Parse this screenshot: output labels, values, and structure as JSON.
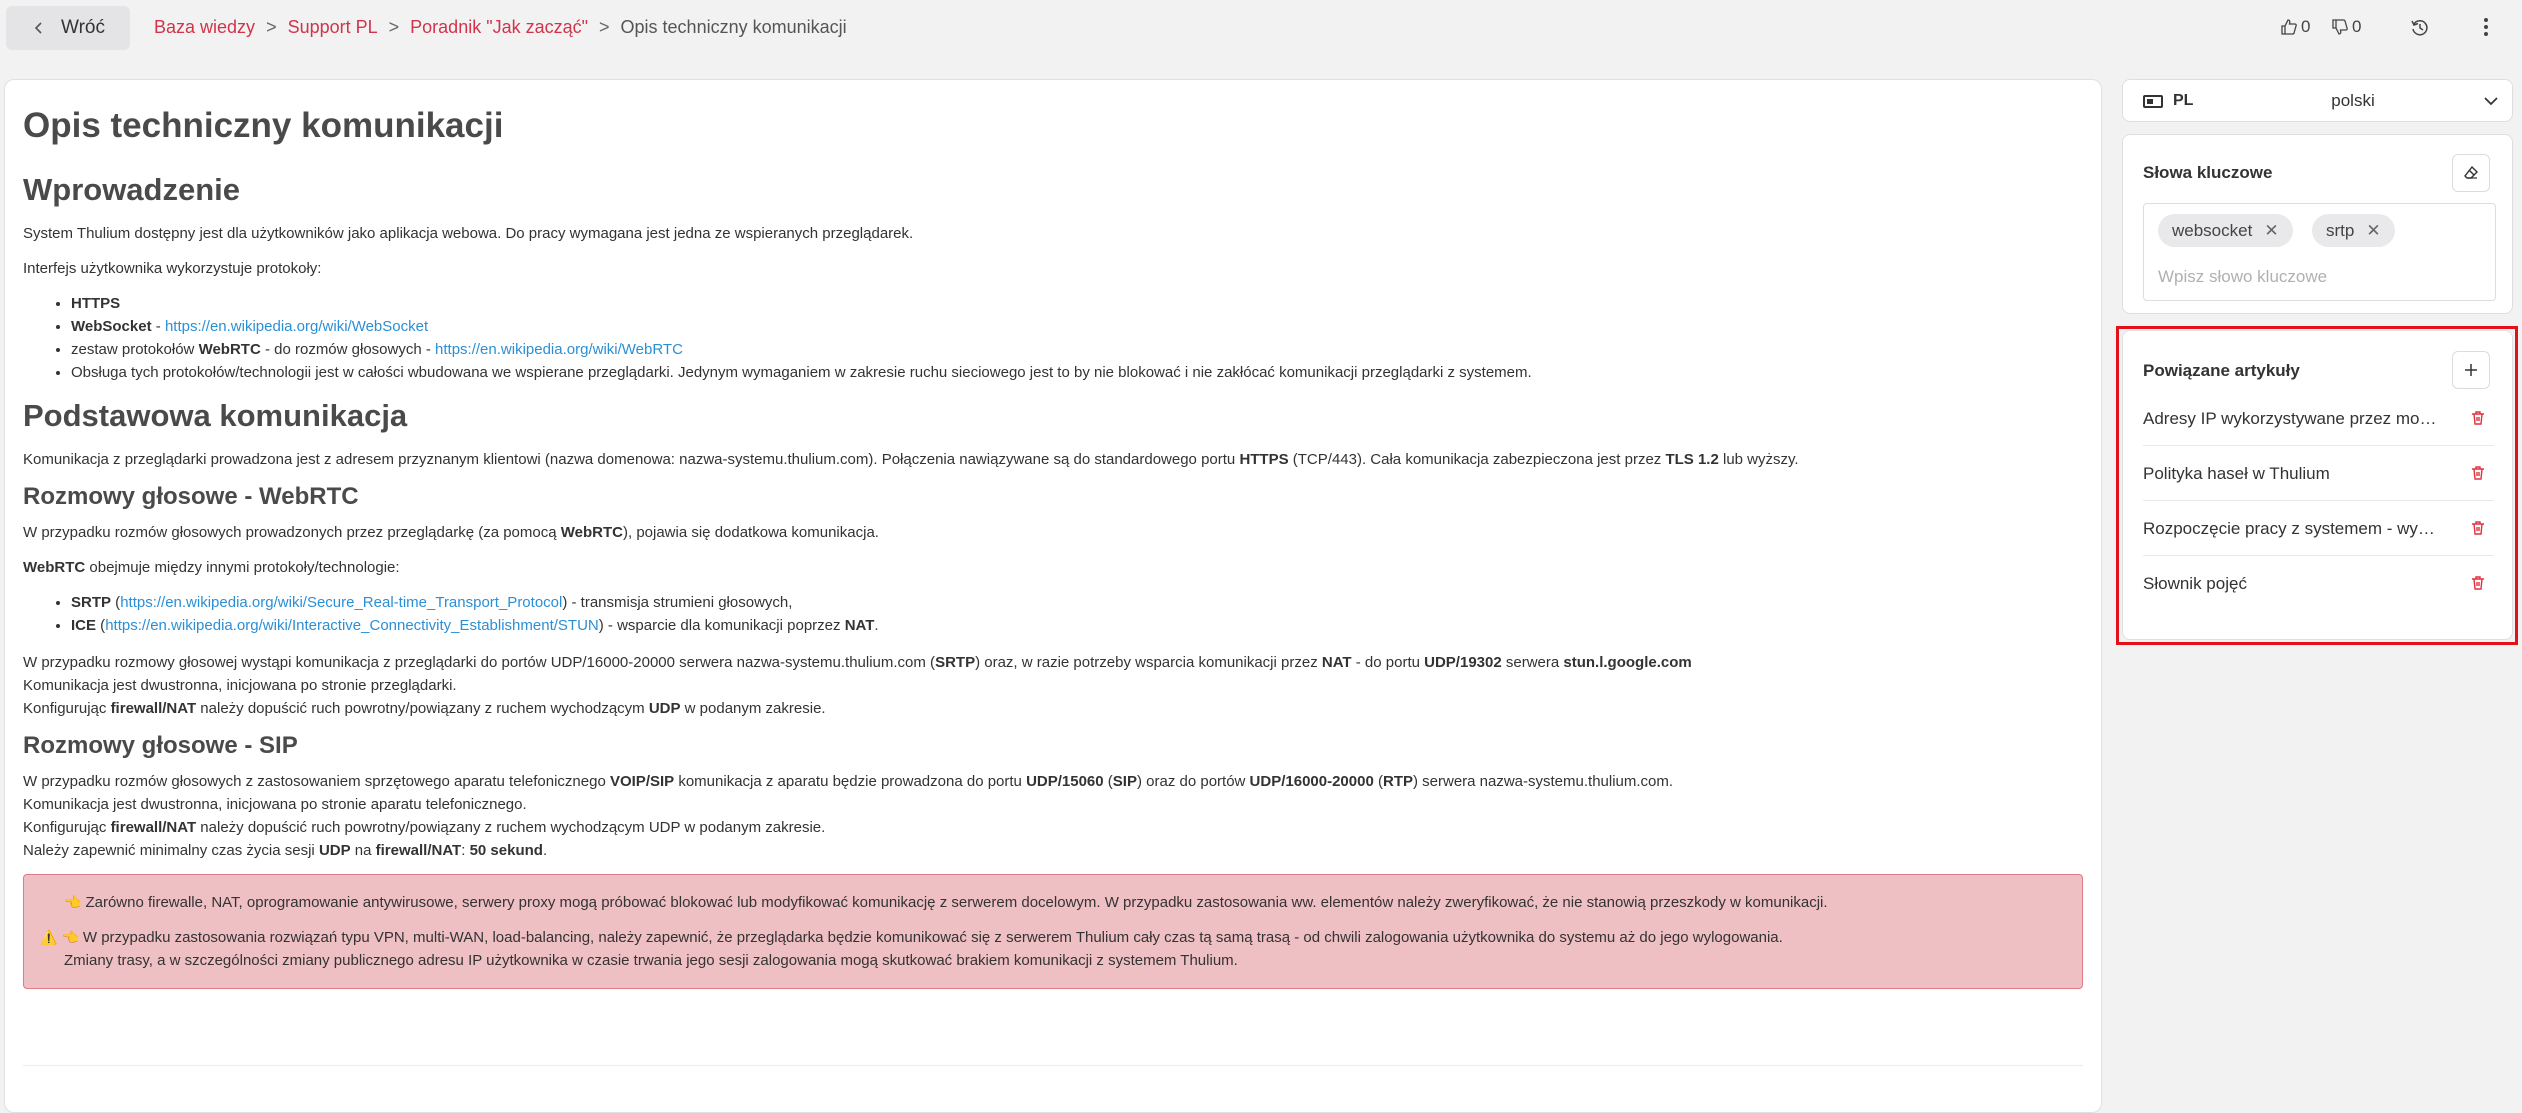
{
  "topbar": {
    "back_label": "Wróć",
    "breadcrumb": [
      {
        "label": "Baza wiedzy"
      },
      {
        "label": "Support PL"
      },
      {
        "label": "Poradnik \"Jak zacząć\""
      }
    ],
    "breadcrumb_separator": ">",
    "breadcrumb_current": "Opis techniczny komunikacji",
    "likes": "0",
    "dislikes": "0",
    "icons": [
      "thumb-up-icon",
      "thumb-down-icon",
      "history-icon",
      "more-vertical-icon"
    ]
  },
  "article": {
    "title": "Opis techniczny komunikacji",
    "s1": {
      "heading": "Wprowadzenie",
      "p1": "System Thulium dostępny jest dla użytkowników jako aplikacja webowa. Do pracy wymagana jest jedna ze wspieranych przeglądarek.",
      "p2": "Interfejs użytkownika wykorzystuje protokoły:",
      "li1_b": "HTTPS",
      "li2_b": "WebSocket",
      "li2_t": " - ",
      "li2_link": "https://en.wikipedia.org/wiki/WebSocket",
      "li3_t1": "zestaw protokołów ",
      "li3_b": "WebRTC",
      "li3_t2": " - do rozmów głosowych - ",
      "li3_link": "https://en.wikipedia.org/wiki/WebRTC",
      "li4": "Obsługa tych protokołów/technologii jest w całości wbudowana we wspierane przeglądarki. Jedynym wymaganiem w zakresie ruchu sieciowego jest to by nie blokować i nie zakłócać komunikacji przeglądarki z systemem."
    },
    "s2": {
      "heading": "Podstawowa komunikacja",
      "p1_t1": "Komunikacja z przeglądarki prowadzona jest z adresem przyznanym klientowi (nazwa domenowa: nazwa-systemu.thulium.com). Połączenia nawiązywane są do standardowego portu ",
      "p1_b1": "HTTPS",
      "p1_t2": " (TCP/443). Cała komunikacja zabezpieczona jest przez ",
      "p1_b2": "TLS 1.2",
      "p1_t3": " lub wyższy."
    },
    "s3": {
      "heading": "Rozmowy głosowe - WebRTC",
      "p1_t1": "W przypadku rozmów głosowych prowadzonych przez przeglądarkę (za pomocą ",
      "p1_b1": "WebRTC",
      "p1_t2": "), pojawia się dodatkowa komunikacja.",
      "p2_b": "WebRTC",
      "p2_t": " obejmuje między innymi protokoły/technologie:",
      "li1_b": "SRTP",
      "li1_t1": " (",
      "li1_link": "https://en.wikipedia.org/wiki/Secure_Real-time_Transport_Protocol",
      "li1_t2": ") - transmisja strumieni głosowych,",
      "li2_b": "ICE",
      "li2_t1": " (",
      "li2_link": "https://en.wikipedia.org/wiki/Interactive_Connectivity_Establishment/STUN",
      "li2_t2": ") - wsparcie dla komunikacji poprzez ",
      "li2_b2": "NAT",
      "li2_t3": ".",
      "p3_t1": "W przypadku rozmowy głosowej wystąpi komunikacja z przeglądarki do portów UDP/16000-20000 serwera nazwa-systemu.thulium.com (",
      "p3_b1": "SRTP",
      "p3_t2": ") oraz, w razie potrzeby wsparcia komunikacji przez ",
      "p3_b2": "NAT",
      "p3_t3": " - do portu ",
      "p3_b3": "UDP/19302",
      "p3_t4": " serwera ",
      "p3_b4": "stun.l.google.com",
      "p4": "Komunikacja jest dwustronna, inicjowana po stronie przeglądarki.",
      "p5_t1": "Konfigurując ",
      "p5_b1": "firewall/NAT",
      "p5_t2": " należy dopuścić ruch powrotny/powiązany z ruchem wychodzącym ",
      "p5_b2": "UDP",
      "p5_t3": " w podanym zakresie."
    },
    "s4": {
      "heading": "Rozmowy głosowe - SIP",
      "p1_t1": "W przypadku rozmów głosowych z zastosowaniem sprzętowego aparatu telefonicznego ",
      "p1_b1": "VOIP/SIP",
      "p1_t2": " komunikacja z aparatu będzie prowadzona do portu ",
      "p1_b2": "UDP/15060",
      "p1_t3": " (",
      "p1_b3": "SIP",
      "p1_t4": ") oraz do portów ",
      "p1_b4": "UDP/16000-20000",
      "p1_t5": " (",
      "p1_b5": "RTP",
      "p1_t6": ") serwera nazwa-systemu.thulium.com.",
      "p2": "Komunikacja jest dwustronna, inicjowana po stronie aparatu telefonicznego.",
      "p3_t1": "Konfigurując ",
      "p3_b1": "firewall/NAT",
      "p3_t2": " należy dopuścić ruch powrotny/powiązany z ruchem wychodzącym UDP w podanym zakresie.",
      "p4_t1": "Należy zapewnić minimalny czas życia sesji ",
      "p4_b1": "UDP",
      "p4_t2": " na ",
      "p4_b2": "firewall/NAT",
      "p4_t3": ": ",
      "p4_b3": "50 sekund",
      "p4_t4": "."
    },
    "alert": {
      "line1": "Zarówno firewalle, NAT, oprogramowanie antywirusowe, serwery proxy mogą próbować blokować lub modyfikować komunikację z serwerem docelowym. W przypadku zastosowania ww. elementów należy zweryfikować, że nie stanowią przeszkody w komunikacji.",
      "line2": "W przypadku zastosowania rozwiązań typu VPN, multi-WAN, load-balancing, należy zapewnić, że przeglądarka będzie komunikować się z serwerem Thulium cały czas tą samą trasą - od chwili zalogowania użytkownika do systemu aż do jego wylogowania.",
      "line3": "Zmiany trasy, a w szczególności zmiany publicznego adresu IP użytkownika w czasie trwania jego sesji zalogowania mogą skutkować brakiem komunikacji z systemem Thulium.",
      "icon_hand": "👈",
      "icon_warning": "⚠️"
    }
  },
  "sidebar": {
    "language": {
      "code": "PL",
      "name": "polski"
    },
    "keywords": {
      "title": "Słowa kluczowe",
      "chips": [
        "websocket",
        "srtp"
      ],
      "chip_remove": "✕",
      "placeholder": "Wpisz słowo kluczowe"
    },
    "related": {
      "title": "Powiązane artykuły",
      "items": [
        "Adresy IP wykorzystywane przez moduły Thulium",
        "Polityka haseł w Thulium",
        "Rozpoczęcie pracy z systemem - wymagania",
        "Słownik pojęć"
      ]
    }
  },
  "colors": {
    "link": "#2b8fd6",
    "breadcrumb_link": "#d1344a",
    "delete_icon": "#e2323f",
    "alert_bg": "#eebfc3",
    "highlight": "#e3121a"
  }
}
